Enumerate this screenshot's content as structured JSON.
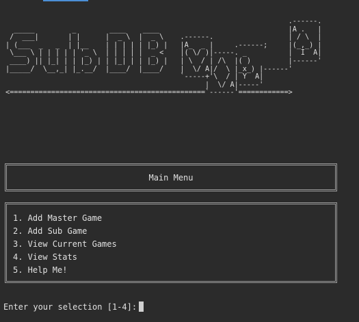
{
  "terminal": {
    "banner_ascii": "                                                                    .------.\n  _____         _        ____    ____                               |A .   |\n /  ___|       | |      |  _ \\  |  _ \\    .------.                  | / \\  |\n| (___  _   _  | |__    | | | | | |_) |   |A_  _ |     .------;     |(_,_) |\n \\___ \\ | | | | | '_ \\  | | | | |  _ <    |( \\/ )|-----. _          |  I  A|\n ____) || |_| | | |_) | | |_| | | |_) |   | \\  / | /\\  |( )         |------'\n|_____/  \\__,_| |_.__/  |____/  |____/    |  \\/ A|/  \\ |_x_) |------'\n                                          `-----+'\\  / | Y  A|\n                                                |  \\/ A|-----'\n<===============================================`------'============>",
    "menu_title": "Main Menu",
    "menu_options": [
      "1. Add Master Game",
      "2. Add Sub Game",
      "3. View Current Games",
      "4. View Stats",
      "5. Help Me!"
    ],
    "prompt": "Enter your selection [1-4]:"
  }
}
